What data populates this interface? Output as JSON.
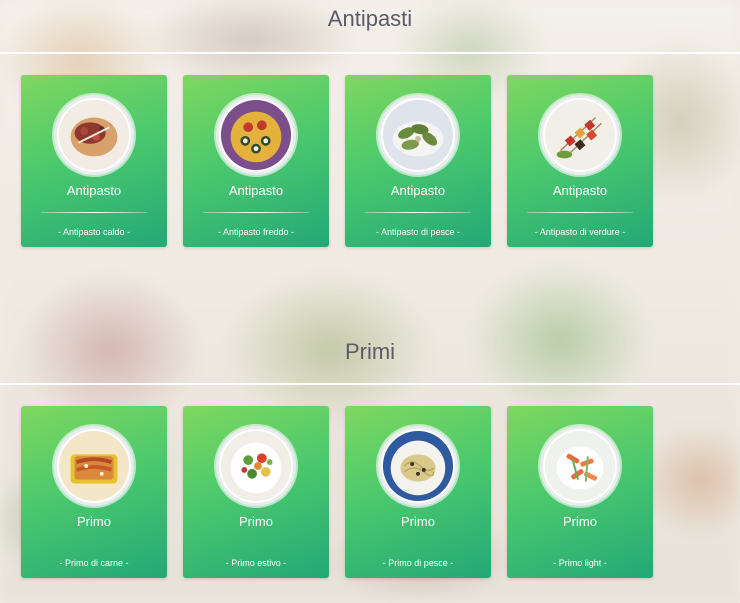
{
  "sections": [
    {
      "title": "Antipasti",
      "cards": [
        {
          "title": "Antipasto",
          "subtitle": "- Antipasto caldo -",
          "icon": "bruschetta-dish-image"
        },
        {
          "title": "Antipasto",
          "subtitle": "- Antipasto freddo -",
          "icon": "sushi-plate-image"
        },
        {
          "title": "Antipasto",
          "subtitle": "- Antipasto di pesce -",
          "icon": "fish-appetizer-image"
        },
        {
          "title": "Antipasto",
          "subtitle": "- Antipasto di verdure -",
          "icon": "vegetable-skewers-image"
        }
      ]
    },
    {
      "title": "Primi",
      "cards": [
        {
          "title": "Primo",
          "subtitle": "- Primo di carne -",
          "icon": "cannelloni-dish-image"
        },
        {
          "title": "Primo",
          "subtitle": "- Primo estivo -",
          "icon": "pasta-salad-image"
        },
        {
          "title": "Primo",
          "subtitle": "- Primo di pesce -",
          "icon": "spaghetti-plate-image"
        },
        {
          "title": "Primo",
          "subtitle": "- Primo light -",
          "icon": "penne-vegetables-image"
        }
      ]
    }
  ],
  "colors": {
    "card_gradient_start": "#7fd85f",
    "card_gradient_end": "#23a877",
    "section_title": "#5b5a66",
    "divider": "#ffffff"
  }
}
